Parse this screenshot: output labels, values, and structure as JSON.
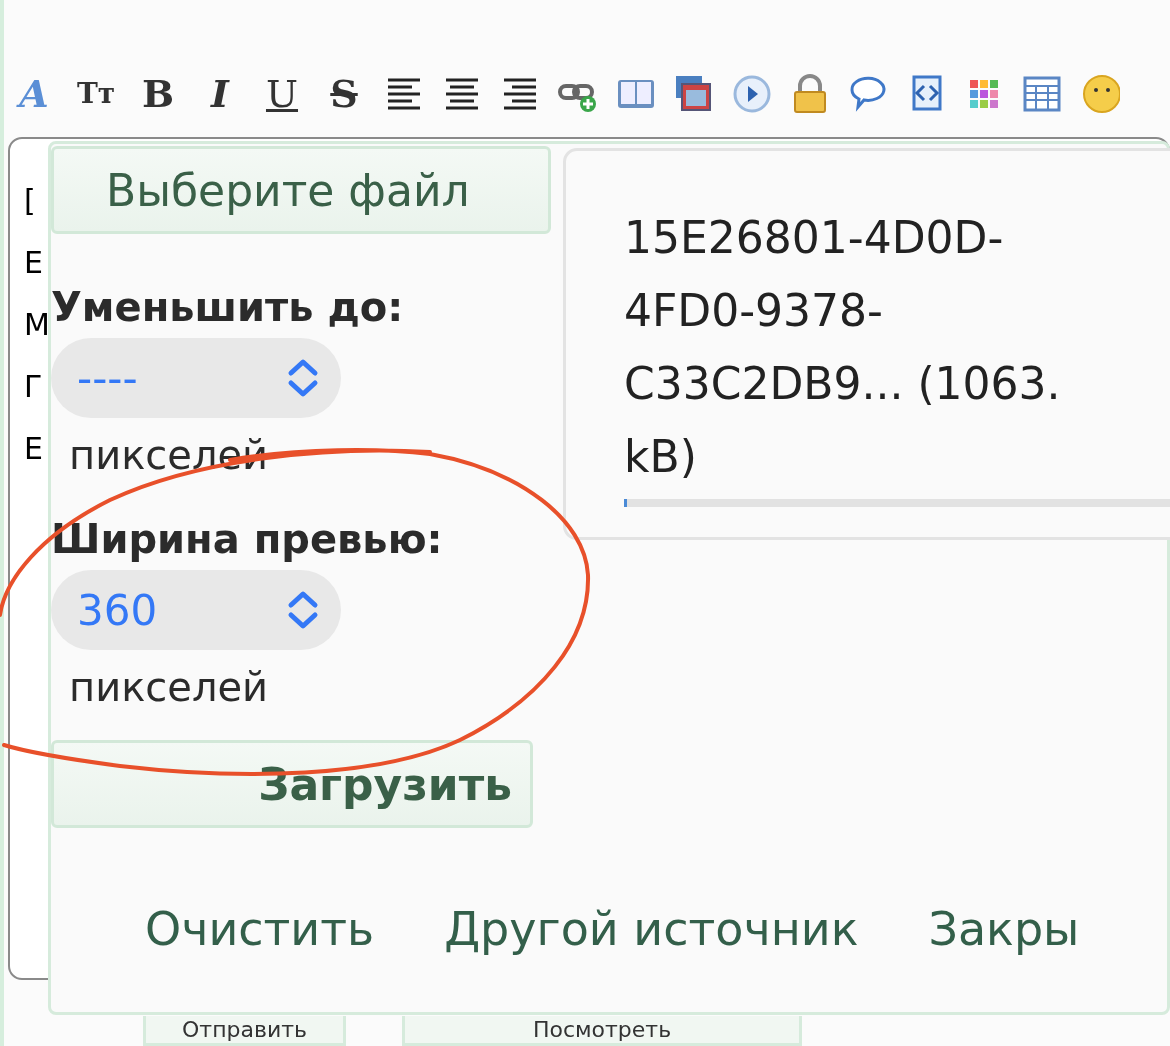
{
  "toolbar": [
    {
      "kind": "font-color",
      "glyph": "A"
    },
    {
      "kind": "font-size",
      "glyph": "Tт"
    },
    {
      "kind": "bold",
      "glyph": "B"
    },
    {
      "kind": "italic",
      "glyph": "I"
    },
    {
      "kind": "underline",
      "glyph": "U"
    },
    {
      "kind": "strike",
      "glyph": "S"
    },
    {
      "kind": "align-left"
    },
    {
      "kind": "align-center"
    },
    {
      "kind": "align-right"
    },
    {
      "kind": "link"
    },
    {
      "kind": "book"
    },
    {
      "kind": "windows"
    },
    {
      "kind": "play"
    },
    {
      "kind": "lock"
    },
    {
      "kind": "bubble"
    },
    {
      "kind": "script"
    },
    {
      "kind": "grid"
    },
    {
      "kind": "table"
    },
    {
      "kind": "smiley"
    }
  ],
  "editor": {
    "text_fragments": [
      "[",
      "Е",
      "М",
      "Г",
      "Е"
    ]
  },
  "upload_dialog": {
    "choose_button": "Выберите файл",
    "resize": {
      "label": "Уменьшить до:",
      "value": "----",
      "unit": "пикселей"
    },
    "preview_width": {
      "label": "Ширина превью:",
      "value": "360",
      "unit": "пикселей"
    },
    "upload_button": "Загрузить",
    "file": {
      "name": "15E26801-4D0D-4FD0-9378-C33C2DB9... (1063. kB)",
      "level": 0.005
    },
    "actions": [
      "Очистить",
      "Другой источник",
      "Закры"
    ]
  },
  "form_buttons": [
    "Отправить",
    "Посмотреть"
  ]
}
